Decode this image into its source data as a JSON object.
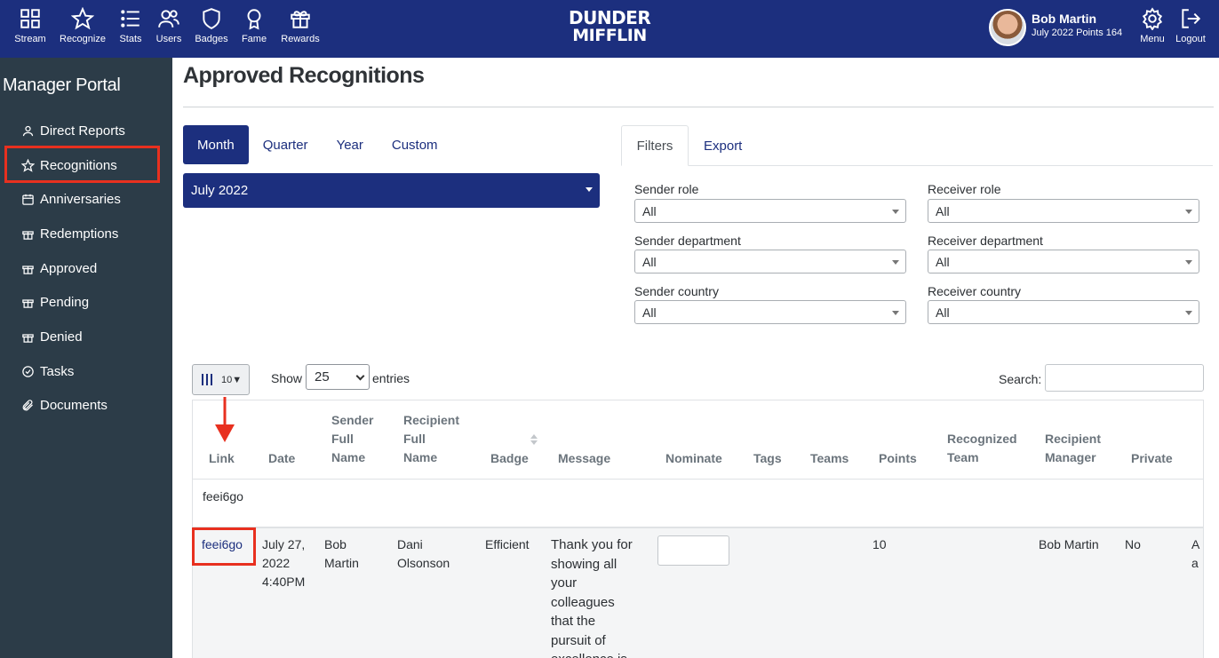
{
  "topnav": {
    "items": [
      {
        "label": "Stream",
        "icon": "grid-icon"
      },
      {
        "label": "Recognize",
        "icon": "star-icon"
      },
      {
        "label": "Stats",
        "icon": "list-icon"
      },
      {
        "label": "Users",
        "icon": "users-icon"
      },
      {
        "label": "Badges",
        "icon": "shield-icon"
      },
      {
        "label": "Fame",
        "icon": "award-icon"
      },
      {
        "label": "Rewards",
        "icon": "gift-icon"
      }
    ],
    "logo_line1": "DUNDER",
    "logo_line2": "MIFFLIN",
    "user_name": "Bob Martin",
    "user_sub": "July 2022 Points 164",
    "menu_label": "Menu",
    "logout_label": "Logout",
    "brand_color": "#1c2f7e"
  },
  "sidebar": {
    "title": "Manager Portal",
    "items": [
      {
        "label": "Direct Reports",
        "icon": "person-icon"
      },
      {
        "label": "Recognitions",
        "icon": "star-icon"
      },
      {
        "label": "Anniversaries",
        "icon": "calendar-icon"
      },
      {
        "label": "Redemptions",
        "icon": "gift-icon"
      },
      {
        "label": "Approved",
        "icon": "gift-icon"
      },
      {
        "label": "Pending",
        "icon": "gift-icon"
      },
      {
        "label": "Denied",
        "icon": "gift-icon"
      },
      {
        "label": "Tasks",
        "icon": "check-circle-icon"
      },
      {
        "label": "Documents",
        "icon": "paperclip-icon"
      }
    ],
    "bg_color": "#2c3c48"
  },
  "main": {
    "title": "Approved Recognitions",
    "period_tabs": [
      "Month",
      "Quarter",
      "Year",
      "Custom"
    ],
    "period_value": "July 2022",
    "filter_tabs": [
      "Filters",
      "Export"
    ],
    "filters": [
      {
        "label": "Sender role",
        "value": "All"
      },
      {
        "label": "Receiver role",
        "value": "All"
      },
      {
        "label": "Sender department",
        "value": "All"
      },
      {
        "label": "Receiver department",
        "value": "All"
      },
      {
        "label": "Sender country",
        "value": "All"
      },
      {
        "label": "Receiver country",
        "value": "All"
      }
    ]
  },
  "table": {
    "columns_button": "10▼",
    "show_label": "Show",
    "entries_value": "25",
    "entries_label": "entries",
    "search_label": "Search:",
    "headers": {
      "link": "Link",
      "date": "Date",
      "sender": [
        "Sender",
        "Full",
        "Name"
      ],
      "recipient": [
        "Recipient",
        "Full",
        "Name"
      ],
      "badge": "Badge",
      "message": "Message",
      "nominate": "Nominate",
      "tags": "Tags",
      "teams": "Teams",
      "points": "Points",
      "recognized_team": [
        "Recognized",
        "Team"
      ],
      "recipient_manager": [
        "Recipient",
        "Manager"
      ],
      "private": "Private"
    },
    "filter_value": "feei6go",
    "rows": [
      {
        "link": "feei6go",
        "date": [
          "July 27,",
          "2022",
          "4:40PM"
        ],
        "sender": [
          "Bob",
          "Martin"
        ],
        "recipient": [
          "Dani",
          "Olsonson"
        ],
        "badge": "Efficient",
        "message": [
          "Thank you for",
          "showing all",
          "your",
          "colleagues",
          "that the",
          "pursuit of",
          "excellence is"
        ],
        "points": "10",
        "recipient_manager": "Bob Martin",
        "private": "No",
        "overflow": [
          "A",
          "a"
        ]
      }
    ]
  },
  "annotations": {
    "highlight_color": "#e8301f"
  }
}
